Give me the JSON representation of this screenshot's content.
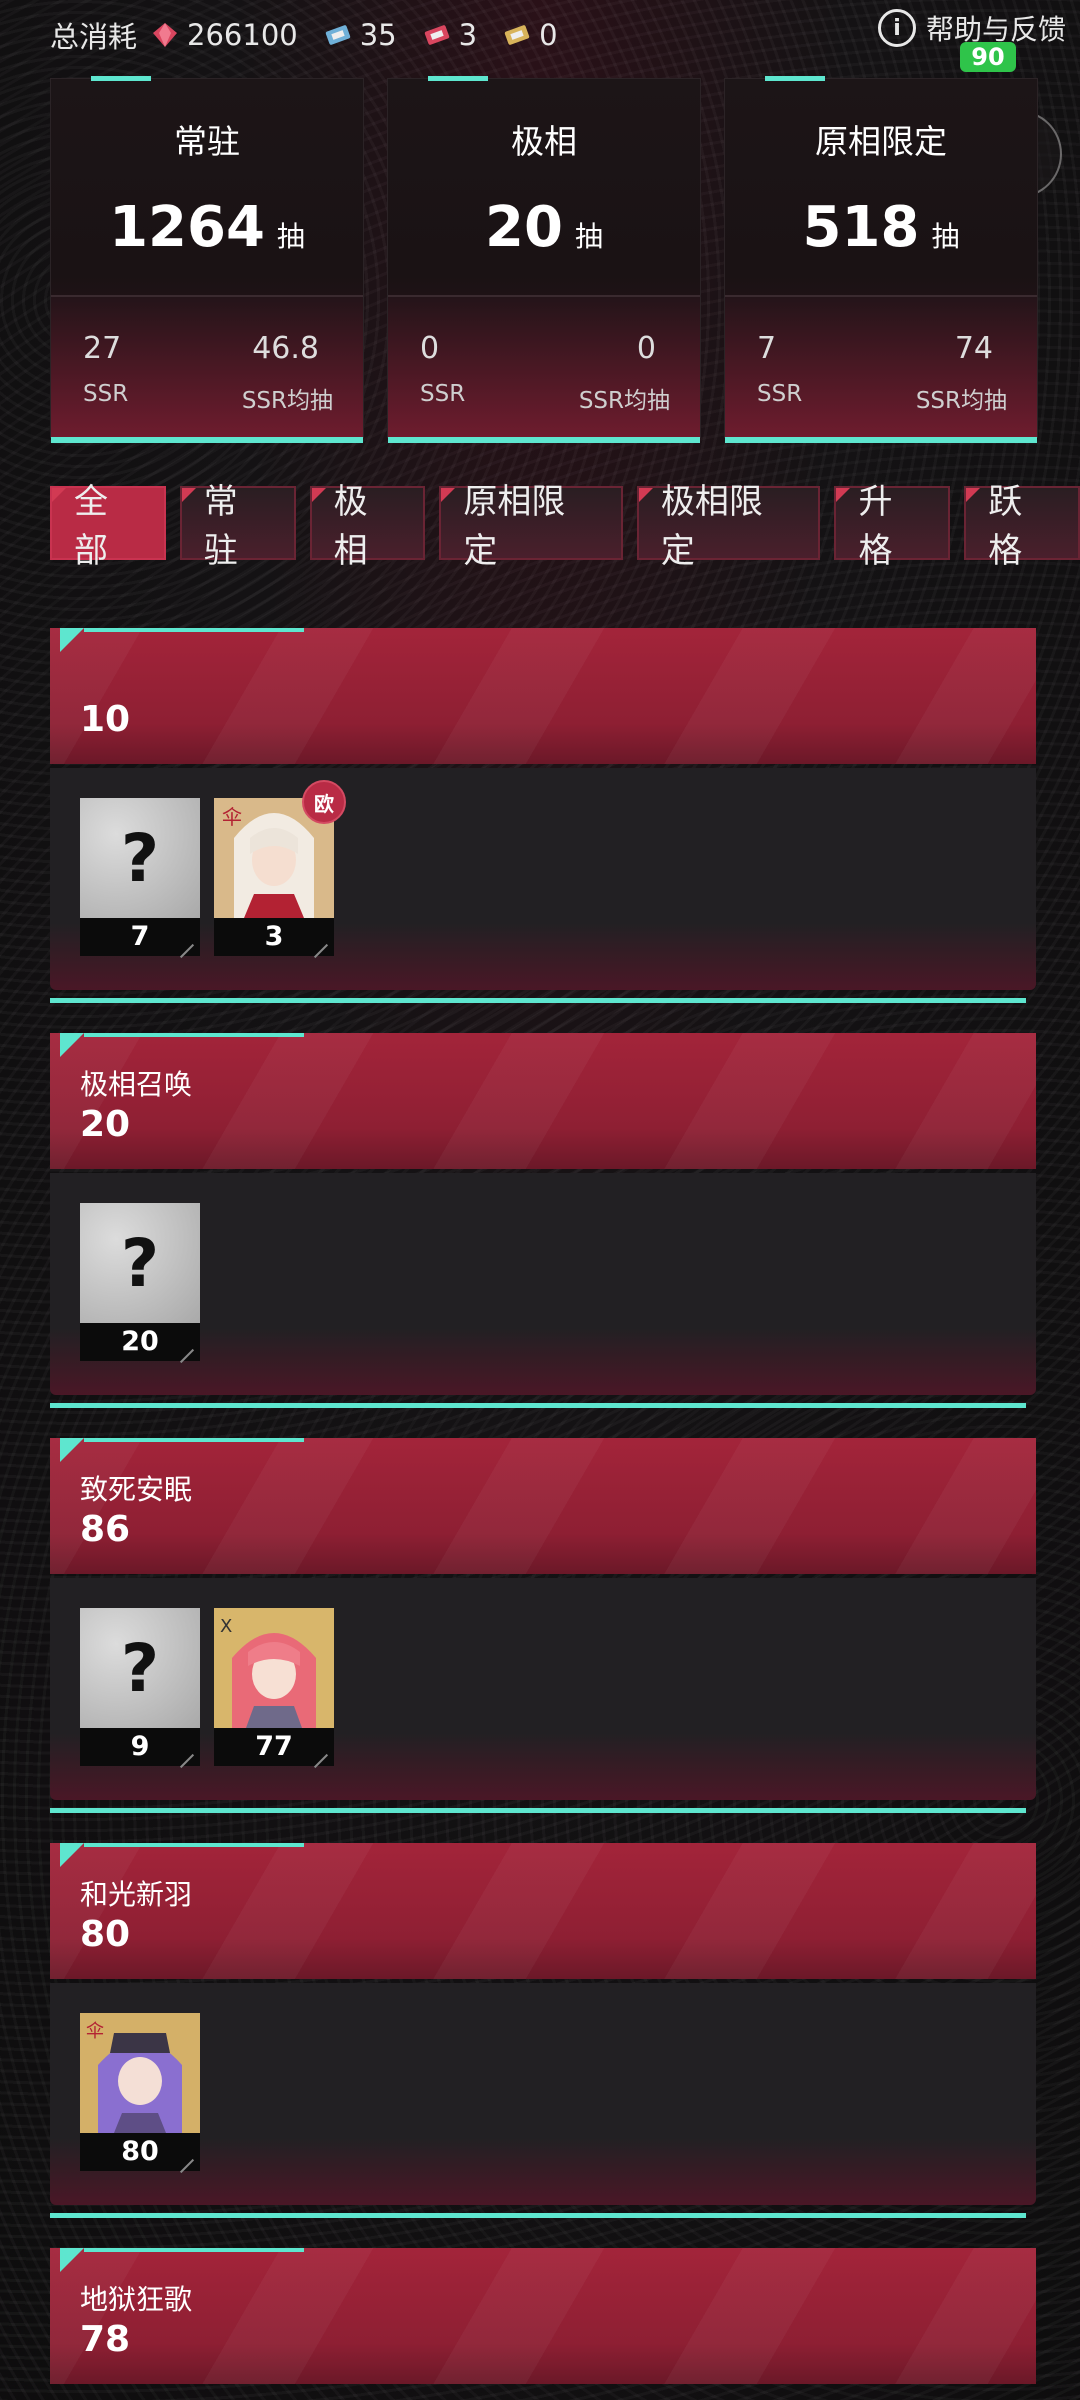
{
  "topbar": {
    "total_label": "总消耗",
    "resources": [
      {
        "icon": "crystal-icon",
        "value": "266100"
      },
      {
        "icon": "ticket-blue-icon",
        "value": "35"
      },
      {
        "icon": "ticket-red-icon",
        "value": "3"
      },
      {
        "icon": "ticket-gold-icon",
        "value": "0"
      }
    ],
    "help_label": "帮助与反馈",
    "battery": "90"
  },
  "stats": [
    {
      "title": "常驻",
      "pulls": "1264",
      "unit": "抽",
      "ssr": "27",
      "ssr_label": "SSR",
      "avg": "46.8",
      "avg_label": "SSR均抽"
    },
    {
      "title": "极相",
      "pulls": "20",
      "unit": "抽",
      "ssr": "0",
      "ssr_label": "SSR",
      "avg": "0",
      "avg_label": "SSR均抽"
    },
    {
      "title": "原相限定",
      "pulls": "518",
      "unit": "抽",
      "ssr": "7",
      "ssr_label": "SSR",
      "avg": "74",
      "avg_label": "SSR均抽"
    }
  ],
  "tabs": [
    "全部",
    "常驻",
    "极相",
    "原相限定",
    "极相限定",
    "升格",
    "跃格"
  ],
  "banners": [
    {
      "name": "",
      "count": "10",
      "tiles": [
        {
          "type": "unknown",
          "count": "7"
        },
        {
          "type": "char-pale",
          "count": "3",
          "badge": "欧"
        }
      ]
    },
    {
      "name": "极相召唤",
      "count": "20",
      "tiles": [
        {
          "type": "unknown",
          "count": "20"
        }
      ]
    },
    {
      "name": "致死安眠",
      "count": "86",
      "tiles": [
        {
          "type": "unknown",
          "count": "9"
        },
        {
          "type": "char-pink",
          "count": "77"
        }
      ]
    },
    {
      "name": "和光新羽",
      "count": "80",
      "tiles": [
        {
          "type": "char-purple",
          "count": "80"
        }
      ]
    },
    {
      "name": "地狱狂歌",
      "count": "78",
      "tiles": []
    }
  ],
  "colors": {
    "accent": "#5ee6cf",
    "primary": "#b92b45"
  }
}
